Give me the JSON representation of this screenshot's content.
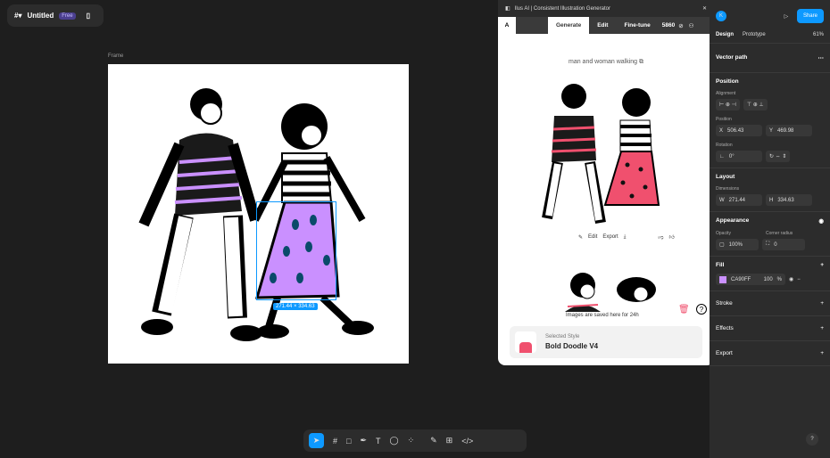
{
  "file": {
    "title": "Untitled",
    "plan_badge": "Free"
  },
  "canvas": {
    "frame_label": "Frame",
    "selection_size": "271.44 × 334.63"
  },
  "plugin": {
    "title": "Ilus AI | Consistent Illustration Generator",
    "tabs": [
      "Generate",
      "Edit",
      "Fine-tune"
    ],
    "credits": "5860",
    "prompt": "man and woman walking",
    "edit_label": "Edit",
    "export_label": "Export",
    "saved_notice": "Images are saved here for 24h",
    "selected_style_label": "Selected Style",
    "selected_style": "Bold Doodle V4"
  },
  "header": {
    "avatar": "K",
    "share": "Share",
    "zoom": "61%",
    "tabs": [
      "Design",
      "Prototype"
    ]
  },
  "panel": {
    "layer": "Vector path",
    "position": "Position",
    "alignment": "Alignment",
    "position_label": "Position",
    "x": "506.43",
    "y": "469.98",
    "rotation_label": "Rotation",
    "rotation": "0°",
    "layout": "Layout",
    "dimensions": "Dimensions",
    "w": "271.44",
    "h": "334.63",
    "appearance": "Appearance",
    "opacity_label": "Opacity",
    "radius_label": "Corner radius",
    "opacity": "100%",
    "radius": "0",
    "fill": "Fill",
    "fill_hex": "CA90FF",
    "fill_opacity": "100",
    "fill_pct": "%",
    "stroke": "Stroke",
    "effects": "Effects",
    "export": "Export"
  },
  "colors": {
    "accent": "#0d99ff",
    "fill": "#CA90FF",
    "pink": "#f0506e"
  }
}
